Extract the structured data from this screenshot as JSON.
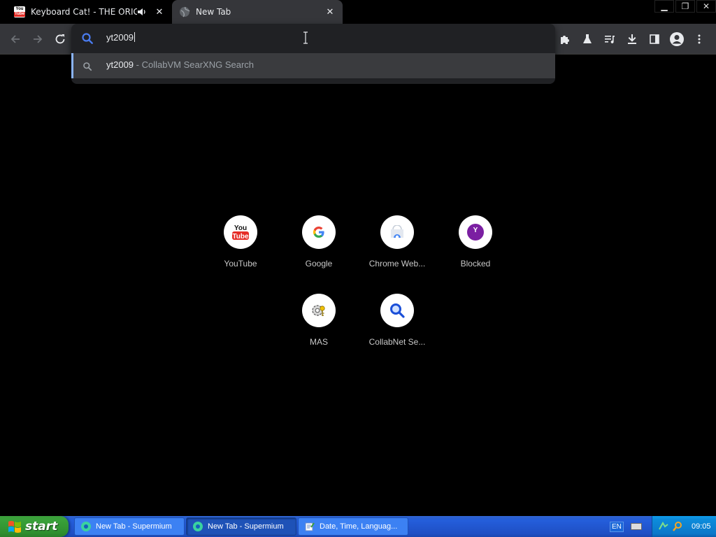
{
  "tabs": [
    {
      "title": "Keyboard Cat! - THE ORIGINAL!",
      "favicon": "youtube-favicon",
      "audio": true,
      "active": false
    },
    {
      "title": "New Tab",
      "favicon": "globe-favicon",
      "active": true
    }
  ],
  "window_controls": {
    "minimize": "minimize-icon",
    "restore": "restore-icon",
    "close": "close-icon"
  },
  "omnibox": {
    "input_value": "yt2009",
    "suggestion": {
      "query": "yt2009",
      "separator": " - ",
      "source": "CollabVM SearXNG Search"
    }
  },
  "shortcuts": [
    {
      "label": "YouTube",
      "icon": "youtube-logo"
    },
    {
      "label": "Google",
      "icon": "google-g-logo"
    },
    {
      "label": "Chrome Web...",
      "icon": "chrome-web-store-logo"
    },
    {
      "label": "Blocked",
      "icon": "yahoo-logo"
    },
    {
      "label": "MAS",
      "icon": "gear-key-icon"
    },
    {
      "label": "CollabNet Se...",
      "icon": "magnifier-icon"
    }
  ],
  "taskbar": {
    "start_label": "start",
    "buttons": [
      {
        "label": "New Tab - Supermium",
        "active": false
      },
      {
        "label": "New Tab - Supermium",
        "active": true
      },
      {
        "label": "Date, Time, Languag...",
        "active": false
      }
    ],
    "language": "EN",
    "clock": "09:05"
  },
  "colors": {
    "toolbar": "#35363a",
    "omnibox": "#202124",
    "accent": "#8ab4f8",
    "taskbar": "#245edb",
    "start": "#3aa23a"
  }
}
